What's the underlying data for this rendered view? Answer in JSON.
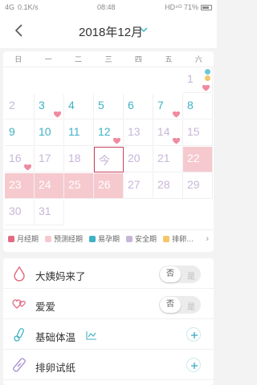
{
  "status_bar": {
    "left": [
      "4G",
      "0.1K/s"
    ],
    "time": "08:48",
    "right": "HD⁴ᴳ 71%"
  },
  "header": {
    "title": "2018年12月"
  },
  "calendar": {
    "weekdays": [
      "日",
      "一",
      "二",
      "三",
      "四",
      "五",
      "六"
    ],
    "today_label": "今",
    "days": [
      {
        "n": "1",
        "col": 6,
        "row": 0,
        "cls": "c-normal",
        "heart": true,
        "minis": [
          "#6bc7d8",
          "#f5c66a"
        ]
      },
      {
        "n": "2",
        "col": 0,
        "row": 1,
        "cls": "c-pred"
      },
      {
        "n": "3",
        "col": 1,
        "row": 1,
        "cls": "c-ov",
        "heart": true
      },
      {
        "n": "4",
        "col": 2,
        "row": 1,
        "cls": "c-ov"
      },
      {
        "n": "5",
        "col": 3,
        "row": 1,
        "cls": "c-ov"
      },
      {
        "n": "6",
        "col": 4,
        "row": 1,
        "cls": "c-ov"
      },
      {
        "n": "7",
        "col": 5,
        "row": 1,
        "cls": "c-ov",
        "heart": true
      },
      {
        "n": "8",
        "col": 6,
        "row": 1,
        "cls": "c-ov"
      },
      {
        "n": "9",
        "col": 0,
        "row": 2,
        "cls": "c-ov"
      },
      {
        "n": "10",
        "col": 1,
        "row": 2,
        "cls": "c-ov"
      },
      {
        "n": "11",
        "col": 2,
        "row": 2,
        "cls": "c-ov"
      },
      {
        "n": "12",
        "col": 3,
        "row": 2,
        "cls": "c-ov",
        "heart": true
      },
      {
        "n": "13",
        "col": 4,
        "row": 2,
        "cls": "c-safe"
      },
      {
        "n": "14",
        "col": 5,
        "row": 2,
        "cls": "c-safe",
        "heart": true
      },
      {
        "n": "15",
        "col": 6,
        "row": 2,
        "cls": "c-safe"
      },
      {
        "n": "16",
        "col": 0,
        "row": 3,
        "cls": "c-safe",
        "heart": true
      },
      {
        "n": "17",
        "col": 1,
        "row": 3,
        "cls": "c-safe"
      },
      {
        "n": "18",
        "col": 2,
        "row": 3,
        "cls": "c-safe"
      },
      {
        "n": "今",
        "col": 3,
        "row": 3,
        "cls": "c-safe",
        "today": true
      },
      {
        "n": "20",
        "col": 4,
        "row": 3,
        "cls": "c-safe"
      },
      {
        "n": "21",
        "col": 5,
        "row": 3,
        "cls": "c-safe"
      },
      {
        "n": "22",
        "col": 6,
        "row": 3,
        "cls": "c-safe",
        "period": true
      },
      {
        "n": "23",
        "col": 0,
        "row": 4,
        "cls": "c-safe",
        "period": true
      },
      {
        "n": "24",
        "col": 1,
        "row": 4,
        "cls": "c-safe",
        "period": true
      },
      {
        "n": "25",
        "col": 2,
        "row": 4,
        "cls": "c-safe",
        "period": true
      },
      {
        "n": "26",
        "col": 3,
        "row": 4,
        "cls": "c-safe",
        "period": true
      },
      {
        "n": "27",
        "col": 4,
        "row": 4,
        "cls": "c-safe"
      },
      {
        "n": "28",
        "col": 5,
        "row": 4,
        "cls": "c-safe"
      },
      {
        "n": "29",
        "col": 6,
        "row": 4,
        "cls": "c-safe"
      },
      {
        "n": "30",
        "col": 0,
        "row": 5,
        "cls": "c-safe"
      },
      {
        "n": "31",
        "col": 1,
        "row": 5,
        "cls": "c-safe"
      }
    ]
  },
  "legend": {
    "items": [
      {
        "label": "月经期",
        "color": "#e46a82"
      },
      {
        "label": "预测经期",
        "color": "#f6c9cf"
      },
      {
        "label": "易孕期",
        "color": "#3fb1c4"
      },
      {
        "label": "安全期",
        "color": "#c7b6d8"
      },
      {
        "label": "排卵…",
        "color": "#f5c66a"
      }
    ],
    "more": "›"
  },
  "records": {
    "period": {
      "label": "大姨妈来了",
      "toggle_on": "否",
      "toggle_off": "是"
    },
    "love": {
      "label": "爱爱",
      "toggle_on": "否",
      "toggle_off": "是"
    },
    "temp": {
      "label": "基础体温"
    },
    "ovulation": {
      "label": "排卵试纸"
    }
  },
  "colors": {
    "accent": "#3fb1c4",
    "period": "#f6c9cf",
    "today_border": "#c6465e"
  }
}
